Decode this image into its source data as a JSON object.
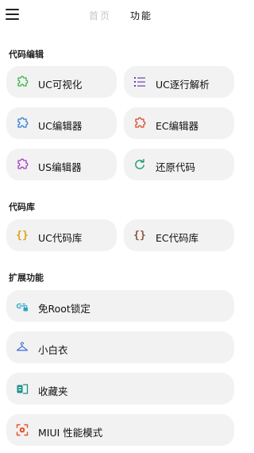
{
  "header": {
    "tabs": [
      {
        "label": "首页",
        "active": false
      },
      {
        "label": "功能",
        "active": true
      }
    ]
  },
  "sections": [
    {
      "title": "代码编辑",
      "items": [
        {
          "label": "UC可视化",
          "icon": "puzzle-icon",
          "color": "#3bb34a"
        },
        {
          "label": "UC逐行解析",
          "icon": "list-icon",
          "color": "#6a3fb8"
        },
        {
          "label": "UC编辑器",
          "icon": "puzzle-icon",
          "color": "#2f7fd8"
        },
        {
          "label": "EC编辑器",
          "icon": "puzzle-icon",
          "color": "#d94a2e"
        },
        {
          "label": "US编辑器",
          "icon": "puzzle-icon",
          "color": "#a83cc4"
        },
        {
          "label": "还原代码",
          "icon": "refresh-icon",
          "color": "#1a9b6b"
        }
      ]
    },
    {
      "title": "代码库",
      "items": [
        {
          "label": "UC代码库",
          "icon": "braces-icon",
          "color": "#e0a21a"
        },
        {
          "label": "EC代码库",
          "icon": "braces-icon",
          "color": "#8a5a3c"
        }
      ]
    },
    {
      "title": "扩展功能",
      "items": [
        {
          "label": "免Root锁定",
          "icon": "link-lock-icon",
          "color": "#2aa3c9"
        },
        {
          "label": "小白衣",
          "icon": "hanger-icon",
          "color": "#4a78d6"
        },
        {
          "label": "收藏夹",
          "icon": "bookmark-icon",
          "color": "#1f8f86"
        },
        {
          "label": "MIUI 性能模式",
          "icon": "performance-icon",
          "color": "#e2552c"
        }
      ]
    }
  ]
}
